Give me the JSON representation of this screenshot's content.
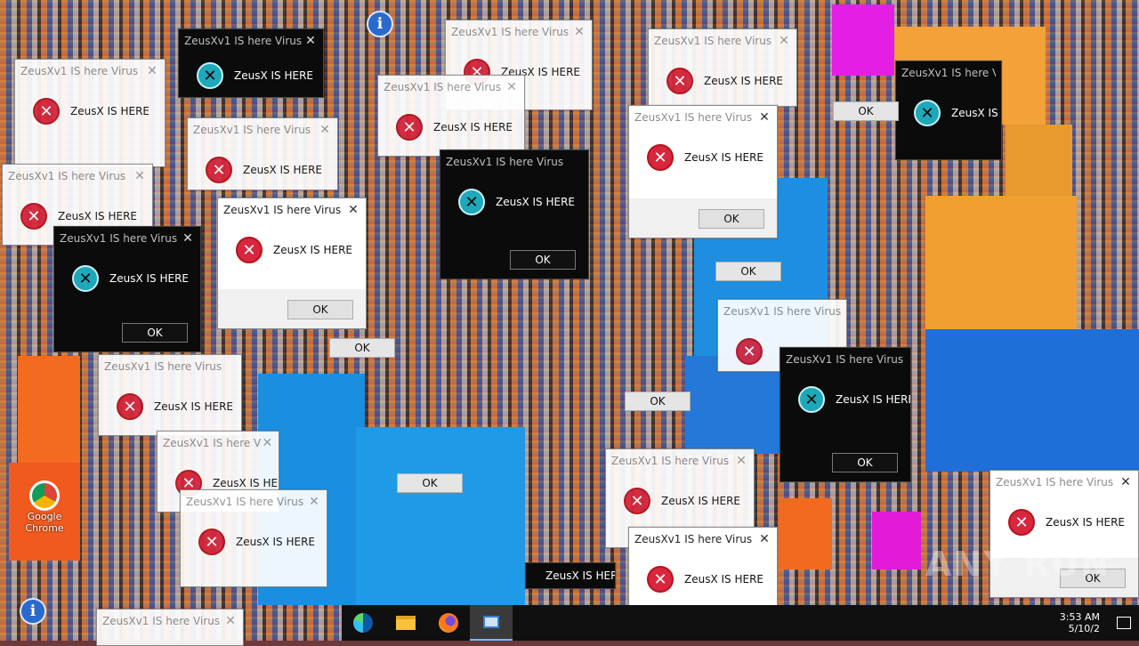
{
  "dialog": {
    "title": "ZeusXv1 IS here Virus",
    "message": "ZeusX IS HERE",
    "ok_label": "OK",
    "close_glyph": "✕",
    "error_glyph": "✕"
  },
  "desktop": {
    "chrome_label": "Google Chrome"
  },
  "taskbar": {
    "apps": [
      "edge-icon",
      "file-explorer-icon",
      "firefox-icon",
      "zeusx-app-icon"
    ],
    "clock_time": "3:53 AM",
    "clock_date": "5/10/2"
  },
  "watermark": "ANY RUN",
  "colors": {
    "error_red": "#d7263d",
    "dark_error_teal": "#1ea8b9",
    "taskbar": "#101010",
    "accent_blue": "#1a8fe0",
    "accent_orange": "#f3a23a"
  }
}
